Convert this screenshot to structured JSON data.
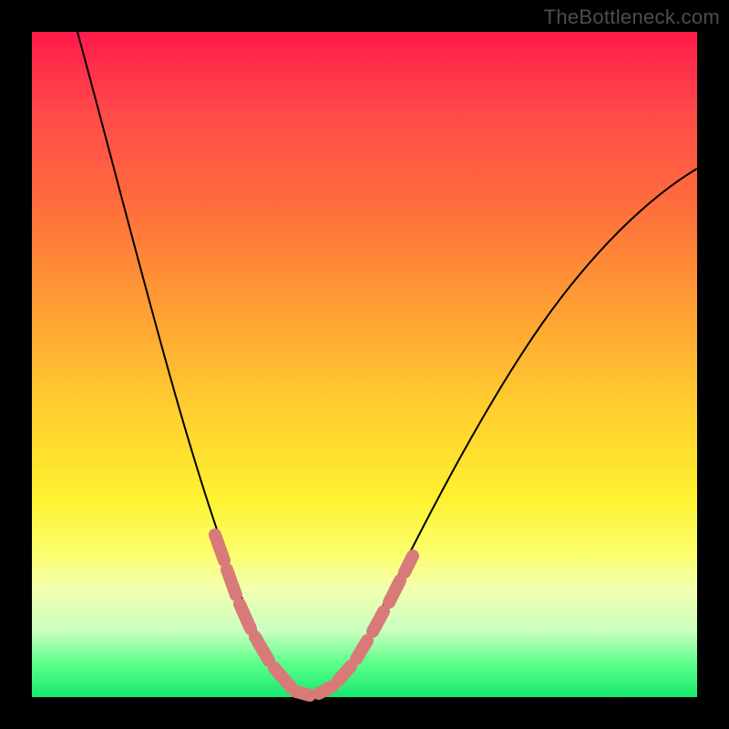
{
  "watermark": "TheBottleneck.com",
  "chart_data": {
    "type": "line",
    "title": "",
    "xlabel": "",
    "ylabel": "",
    "xlim": [
      0,
      100
    ],
    "ylim": [
      0,
      100
    ],
    "grid": false,
    "legend": false,
    "series": [
      {
        "name": "curve",
        "color": "#000000",
        "x": [
          7,
          10,
          15,
          20,
          23,
          26,
          29,
          32,
          35,
          37,
          40,
          45,
          50,
          55,
          60,
          65,
          70,
          75,
          80,
          85,
          90,
          95,
          100
        ],
        "y": [
          100,
          90,
          75,
          60,
          50,
          40,
          30,
          18,
          8,
          3,
          0,
          3,
          10,
          20,
          31,
          42,
          52,
          60,
          66,
          71,
          75,
          78,
          80
        ]
      }
    ],
    "highlight_segments": [
      {
        "name": "left-overlay",
        "color": "#d87a78",
        "x": [
          26,
          29,
          32,
          35,
          37,
          40
        ],
        "y": [
          40,
          30,
          18,
          8,
          3,
          0
        ]
      },
      {
        "name": "right-overlay",
        "color": "#d87a78",
        "x": [
          40,
          43,
          46,
          49,
          52,
          55
        ],
        "y": [
          0,
          2,
          5,
          9,
          14,
          20
        ]
      }
    ],
    "background_gradient": {
      "top": "#ff1a4a",
      "mid": "#fff12f",
      "bottom": "#17e86f"
    }
  }
}
